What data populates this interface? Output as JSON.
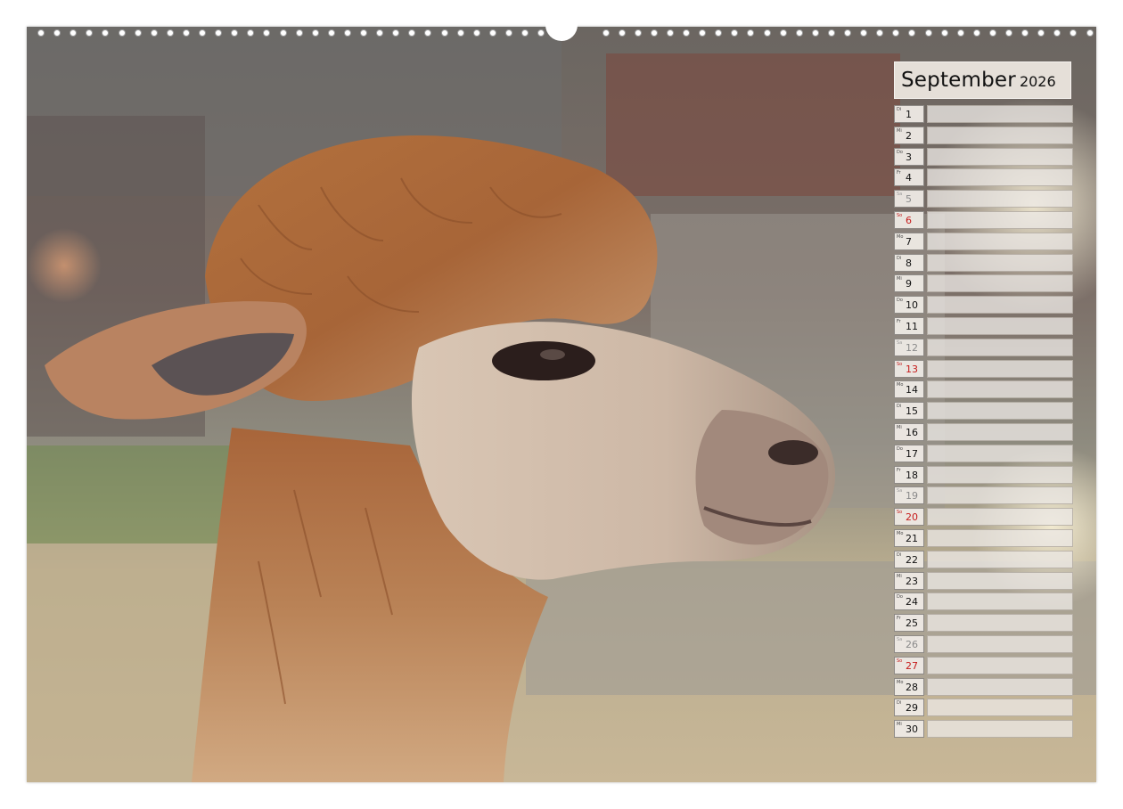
{
  "calendar": {
    "month": "September",
    "year": "2026",
    "days": [
      {
        "dow": "Di",
        "num": "1",
        "type": "weekday"
      },
      {
        "dow": "Mi",
        "num": "2",
        "type": "weekday"
      },
      {
        "dow": "Do",
        "num": "3",
        "type": "weekday"
      },
      {
        "dow": "Fr",
        "num": "4",
        "type": "weekday"
      },
      {
        "dow": "Sa",
        "num": "5",
        "type": "sat"
      },
      {
        "dow": "So",
        "num": "6",
        "type": "sun"
      },
      {
        "dow": "Mo",
        "num": "7",
        "type": "weekday"
      },
      {
        "dow": "Di",
        "num": "8",
        "type": "weekday"
      },
      {
        "dow": "Mi",
        "num": "9",
        "type": "weekday"
      },
      {
        "dow": "Do",
        "num": "10",
        "type": "weekday"
      },
      {
        "dow": "Fr",
        "num": "11",
        "type": "weekday"
      },
      {
        "dow": "Sa",
        "num": "12",
        "type": "sat"
      },
      {
        "dow": "So",
        "num": "13",
        "type": "sun"
      },
      {
        "dow": "Mo",
        "num": "14",
        "type": "weekday"
      },
      {
        "dow": "Di",
        "num": "15",
        "type": "weekday"
      },
      {
        "dow": "Mi",
        "num": "16",
        "type": "weekday"
      },
      {
        "dow": "Do",
        "num": "17",
        "type": "weekday"
      },
      {
        "dow": "Fr",
        "num": "18",
        "type": "weekday"
      },
      {
        "dow": "Sa",
        "num": "19",
        "type": "sat"
      },
      {
        "dow": "So",
        "num": "20",
        "type": "sun"
      },
      {
        "dow": "Mo",
        "num": "21",
        "type": "weekday"
      },
      {
        "dow": "Di",
        "num": "22",
        "type": "weekday"
      },
      {
        "dow": "Mi",
        "num": "23",
        "type": "weekday"
      },
      {
        "dow": "Do",
        "num": "24",
        "type": "weekday"
      },
      {
        "dow": "Fr",
        "num": "25",
        "type": "weekday"
      },
      {
        "dow": "Sa",
        "num": "26",
        "type": "sat"
      },
      {
        "dow": "So",
        "num": "27",
        "type": "sun"
      },
      {
        "dow": "Mo",
        "num": "28",
        "type": "weekday"
      },
      {
        "dow": "Di",
        "num": "29",
        "type": "weekday"
      },
      {
        "dow": "Mi",
        "num": "30",
        "type": "weekday"
      }
    ]
  },
  "photo": {
    "subject": "alpaca-head-icon"
  },
  "colors": {
    "sunday": "#c61b1b",
    "saturday": "#8a8a8a",
    "weekday": "#111111"
  }
}
